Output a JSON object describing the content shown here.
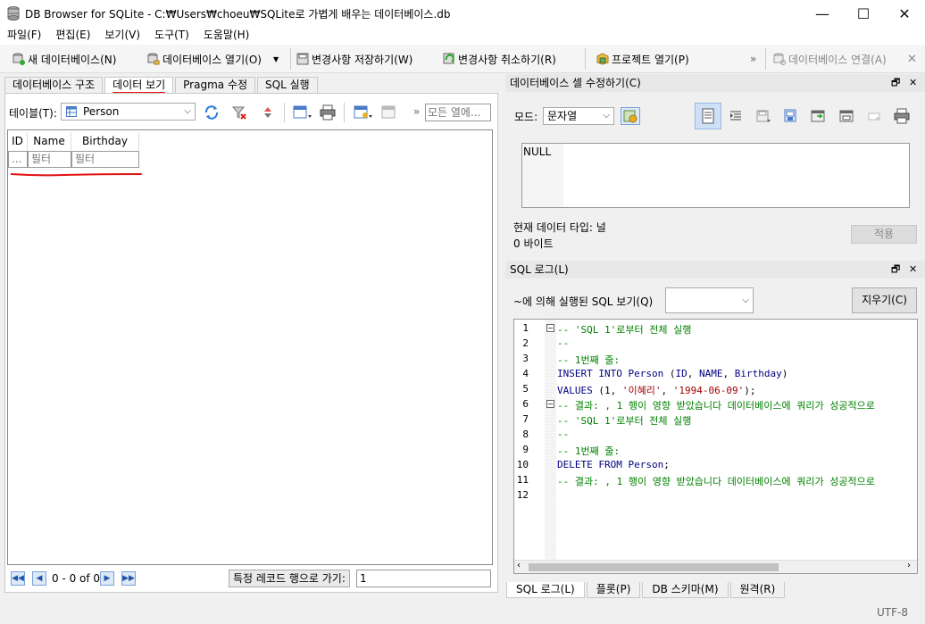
{
  "window": {
    "title": "DB Browser for SQLite - C:₩Users₩choeu₩SQLite로 가볍게 배우는 데이터베이스.db",
    "minimize": "—",
    "maximize": "☐",
    "close": "✕"
  },
  "menu": [
    "파일(F)",
    "편집(E)",
    "보기(V)",
    "도구(T)",
    "도움말(H)"
  ],
  "toolbar": {
    "new_db": "새 데이터베이스(N)",
    "open_db": "데이터베이스 열기(O)",
    "save_changes": "변경사항 저장하기(W)",
    "revert_changes": "변경사항 취소하기(R)",
    "open_project": "프로젝트 열기(P)",
    "more": "»",
    "attach_db": "데이터베이스 연결(A)",
    "close_db": "✕"
  },
  "tabs": [
    "데이터베이스 구조",
    "데이터 보기",
    "Pragma 수정",
    "SQL 실행"
  ],
  "browse": {
    "table_label": "테이블(T):",
    "table_value": "Person",
    "more": "»",
    "filter_all_placeholder": "모든 열에...",
    "columns": [
      "ID",
      "Name",
      "Birthday"
    ],
    "filter_placeholders": [
      "...",
      "필터",
      "필터"
    ],
    "nav_first": "◀◀",
    "nav_prev": "◀",
    "nav_next": "▶",
    "nav_last": "▶▶",
    "record_count": "0 - 0 of 0",
    "goto_label": "특정 레코드 행으로 가기:",
    "goto_value": "1"
  },
  "edit_cell": {
    "title": "데이터베이스 셀 수정하기(C)",
    "mode_label": "모드:",
    "mode_value": "문자열",
    "content": "NULL",
    "type_text": "현재 데이터 타입: 널",
    "size_text": "0 바이트",
    "apply_button": "적용"
  },
  "sql_log": {
    "title": "SQL 로그(L)",
    "filter_label": "~에 의해 실행된 SQL 보기(Q)",
    "filter_value": "",
    "clear_button": "지우기(C)",
    "lines": [
      {
        "n": "1",
        "parts": [
          [
            "cm",
            "-- 'SQL 1'로부터 전체 실행"
          ]
        ]
      },
      {
        "n": "2",
        "parts": [
          [
            "cm",
            "--"
          ]
        ]
      },
      {
        "n": "3",
        "parts": [
          [
            "cm",
            "-- 1번째 줄:"
          ]
        ]
      },
      {
        "n": "4",
        "parts": [
          [
            "kw",
            "INSERT INTO "
          ],
          [
            "idn",
            "Person"
          ],
          [
            "pl",
            " ("
          ],
          [
            "idn",
            "ID"
          ],
          [
            "pl",
            ", "
          ],
          [
            "idn",
            "NAME"
          ],
          [
            "pl",
            ", "
          ],
          [
            "idn",
            "Birthday"
          ],
          [
            "pl",
            ")"
          ]
        ]
      },
      {
        "n": "5",
        "parts": [
          [
            "kw",
            "VALUES "
          ],
          [
            "pl",
            "(1, "
          ],
          [
            "str",
            "'이혜리'"
          ],
          [
            "pl",
            ", "
          ],
          [
            "str",
            "'1994-06-09'"
          ],
          [
            "pl",
            ");"
          ]
        ]
      },
      {
        "n": "6",
        "parts": [
          [
            "cm",
            "-- 결과: , 1 행이 영향 받았습니다 데이터베이스에 쿼리가 성공적으로"
          ]
        ]
      },
      {
        "n": "7",
        "parts": [
          [
            "cm",
            "-- 'SQL 1'로부터 전체 실행"
          ]
        ]
      },
      {
        "n": "8",
        "parts": [
          [
            "cm",
            "--"
          ]
        ]
      },
      {
        "n": "9",
        "parts": [
          [
            "cm",
            "-- 1번째 줄:"
          ]
        ]
      },
      {
        "n": "10",
        "parts": [
          [
            "kw",
            "DELETE FROM "
          ],
          [
            "idn",
            "Person"
          ],
          [
            "pl",
            ";"
          ]
        ]
      },
      {
        "n": "11",
        "parts": [
          [
            "cm",
            "-- 결과: , 1 행이 영향 받았습니다 데이터베이스에 쿼리가 성공적으로"
          ]
        ]
      },
      {
        "n": "12",
        "parts": []
      }
    ]
  },
  "bottom_tabs": [
    "SQL 로그(L)",
    "플롯(P)",
    "DB 스키마(M)",
    "원격(R)"
  ],
  "status": {
    "encoding": "UTF-8"
  },
  "colors": {
    "red_annotation": "#e11111",
    "comment": "#008000",
    "keyword": "#000080",
    "string": "#a00000"
  }
}
